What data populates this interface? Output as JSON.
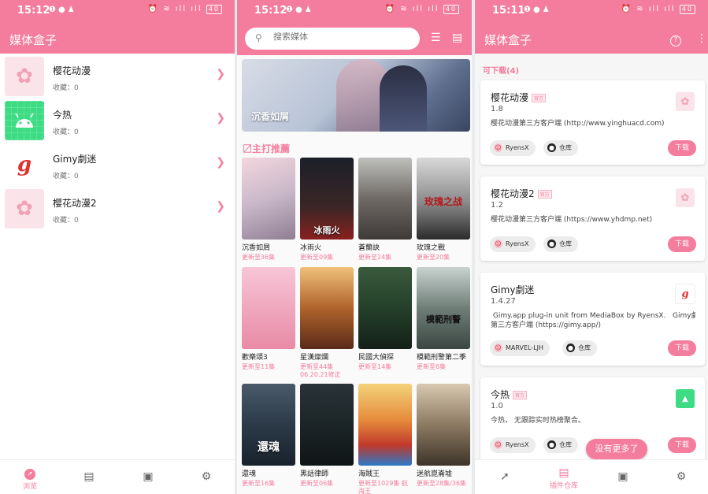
{
  "colors": {
    "accent": "#f47c9c",
    "background": "#ffffff",
    "text": "#222222"
  },
  "panel1": {
    "status": {
      "time": "15:12",
      "battery": "40"
    },
    "title": "媒体盒子",
    "items": [
      {
        "name": "樱花动漫",
        "sub": "收藏：0",
        "icon": "sakura-icon"
      },
      {
        "name": "今热",
        "sub": "收藏：0",
        "icon": "android-icon"
      },
      {
        "name": "Gimy劇迷",
        "sub": "收藏：0",
        "icon": "gimy-logo-icon"
      },
      {
        "name": "樱花动漫2",
        "sub": "收藏：0",
        "icon": "sakura-icon"
      }
    ],
    "nav": [
      {
        "icon": "compass-icon",
        "label": "浏览"
      },
      {
        "icon": "storage-icon",
        "label": ""
      },
      {
        "icon": "download-box-icon",
        "label": ""
      },
      {
        "icon": "gear-icon",
        "label": ""
      }
    ]
  },
  "panel2": {
    "status": {
      "time": "15:12",
      "battery": "40"
    },
    "search": {
      "placeholder": "搜索媒体"
    },
    "banner_caption": "沉香如屑",
    "section_title": "〼主打推薦",
    "cards": [
      {
        "title": "沉香如屑",
        "update": "更新至36集"
      },
      {
        "title": "冰雨火",
        "update": "更新至09集"
      },
      {
        "title": "蒼蘭訣",
        "update": "更新至24集"
      },
      {
        "title": "玫瑰之戰",
        "update": "更新至20集"
      },
      {
        "title": "歡樂頌3",
        "update": "更新至11集"
      },
      {
        "title": "星漢燦爛",
        "update": "更新至44集 06.20.21修正"
      },
      {
        "title": "民國大偵探",
        "update": "更新至14集"
      },
      {
        "title": "模範刑警第二季",
        "update": "更新至6集"
      },
      {
        "title": "還魂",
        "update": "更新至16集"
      },
      {
        "title": "黑話律師",
        "update": "更新至06集"
      },
      {
        "title": "海賊王",
        "update": "更新至1029集 航海王"
      },
      {
        "title": "迷航崑崙墟",
        "update": "更新至28集/36集"
      }
    ],
    "poster_texts": [
      "",
      "冰雨火",
      "",
      "玫瑰之战",
      "",
      "",
      "",
      "模範刑警",
      "還魂",
      "",
      "",
      ""
    ]
  },
  "panel3": {
    "status": {
      "time": "15:11",
      "battery": "40"
    },
    "title": "媒体盒子",
    "downloadable": "可下载(4)",
    "tag": "官方",
    "download_label": "下载",
    "repo_label": "仓库",
    "plugins": [
      {
        "name": "樱花动漫",
        "official": true,
        "version": "1.8",
        "desc": "樱花动漫第三方客户端 (http://www.yinghuacd.com)",
        "author": "RyensX",
        "icon": "sakura-icon"
      },
      {
        "name": "樱花动漫2",
        "official": true,
        "version": "1.2",
        "desc": "樱花动漫第三方客户端 (https://www.yhdmp.net)",
        "author": "RyensX",
        "icon": "sakura-icon"
      },
      {
        "name": "Gimy劇迷",
        "official": false,
        "version": "1.4.27",
        "desc": " Gimy.app plug-in unit from MediaBox by RyensX.   Gimy劇\n第三方客户端 (https://gimy.app/)",
        "author": "MARVEL-LJH",
        "icon": "gimy-logo-icon"
      },
      {
        "name": "今热",
        "official": true,
        "version": "1.0",
        "desc": "今热， 无跟踪实时热榜聚合。",
        "author": "RyensX",
        "icon": "android-icon"
      }
    ],
    "toast": "没有更多了",
    "nav": [
      {
        "icon": "compass-icon",
        "label": ""
      },
      {
        "icon": "storage-icon",
        "label": "插件仓库"
      },
      {
        "icon": "download-box-icon",
        "label": ""
      },
      {
        "icon": "gear-icon",
        "label": ""
      }
    ]
  }
}
